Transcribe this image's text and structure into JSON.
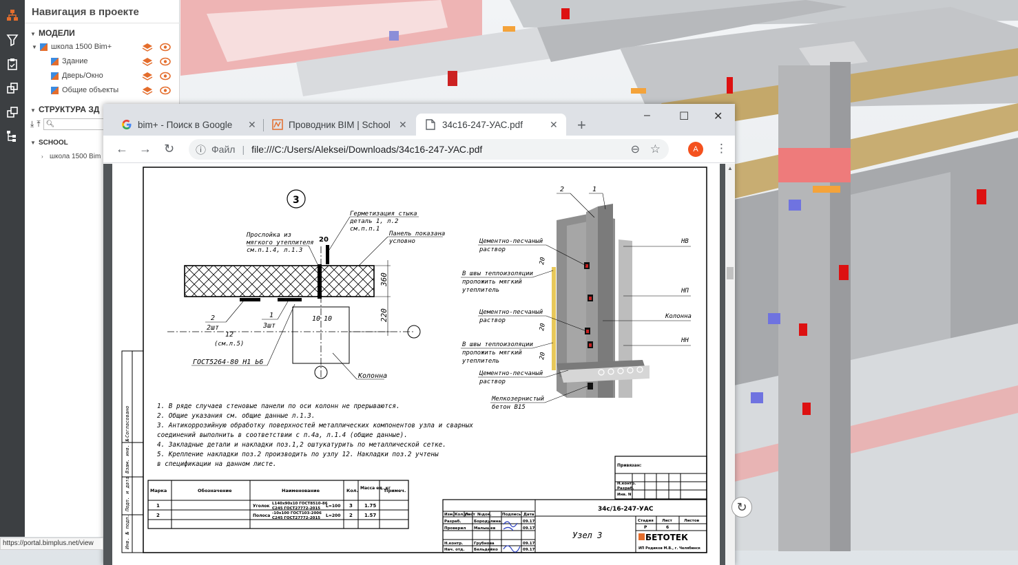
{
  "nav": {
    "title": "Навигация в проекте",
    "models_label": "МОДЕЛИ",
    "model_name": "школа 1500 Bim+",
    "sub_items": [
      "Здание",
      "Дверь/Окно",
      "Общие объекты"
    ],
    "structure_label": "СТРУКТУРА ЗД",
    "school_label": "SCHOOL",
    "school_item": "школа 1500 Bim"
  },
  "browser": {
    "tabs": [
      {
        "title": "bim+ - Поиск в Google",
        "icon": "google-icon"
      },
      {
        "title": "Проводник BIM | School",
        "icon": "bimplus-icon"
      },
      {
        "title": "34c16-247-УАС.pdf",
        "icon": "document-icon"
      }
    ],
    "new_tab": "+",
    "window_controls": {
      "minimize": "–",
      "maximize": "☐",
      "close": "✕"
    },
    "address_label": "Файл",
    "url": "file:///C:/Users/Aleksei/Downloads/34c16-247-УАС.pdf",
    "avatar_letter": "A"
  },
  "drawing": {
    "node_number": "3",
    "labels": {
      "seal": "Герметизация стыка",
      "seal2": "деталь 1, л.2",
      "seal3": "см.п.п.1",
      "panel": "Панель показана",
      "panel2": "условно",
      "gasket": "Прослойка из",
      "gasket2": "мягкого утеплителя",
      "gasket3": "см.п.1.4, л.1.3",
      "d20": "20",
      "d360": "360",
      "d220": "220",
      "d10a": "10",
      "d10b": "10",
      "p2": "2",
      "p2qty": "2шт",
      "p1": "1",
      "p1qty": "3шт",
      "p12": "12",
      "p12ref": "(см.л.5)",
      "gost": "ГОСТ5264-80 Н1 Ь6",
      "column": "Колонна"
    },
    "iso_labels": {
      "n2": "2",
      "n1": "1",
      "mortar1": "Цементно-песчаный",
      "mortar1b": "раствор",
      "joints1": "В швы теплоизоляции",
      "joints1b": "проложить мягкий",
      "joints1c": "утеплитель",
      "mortar2": "Цементно-песчаный",
      "mortar2b": "раствор",
      "joints2": "В швы теплоизоляции",
      "joints2b": "проложить мягкий",
      "joints2c": "утеплитель",
      "mortar3": "Цементно-песчаный",
      "mortar3b": "раствор",
      "concrete": "Мелкозернистый",
      "concrete2": "бетон В15",
      "hv": "НВ",
      "np": "НП",
      "column": "Колонна",
      "nn": "НН",
      "d20a": "20",
      "d20b": "20",
      "d20c": "20"
    },
    "notes": [
      "1. В ряде случаев стеновые панели по оси колонн не прерываются.",
      "2. Общие указания см. общие данные л.1.3.",
      "3. Антикоррозийную обработку поверхностей металлических компонентов узла и сварных",
      "соединений выполнить в соответствии с п.4а, л.1.4 (общие данные).",
      "4. Закладные детали и накладки поз.1,2 оштукатурить по металлической сетке.",
      "5. Крепление накладки поз.2 производить по узлу 12. Накладки поз.2 учтены",
      "в спецификации на данном листе."
    ],
    "spec_headers": [
      "Марка",
      "Обозначение",
      "Наименование",
      "Кол.",
      "Масса ед.,кг",
      "Примеч."
    ],
    "spec_rows": [
      {
        "mark": "1",
        "name_a": "Уголок",
        "name_b": "L140x90x10 ГОСТ8510-86",
        "name_c": "С245 ГОСТ27772-2015",
        "len": "L=100",
        "qty": "3",
        "mass": "1.75"
      },
      {
        "mark": "2",
        "name_a": "Полоса",
        "name_b": "-10x100 ГОСТ103-2006",
        "name_c": "С245 ГОСТ27772-2015",
        "len": "L=200",
        "qty": "2",
        "mass": "1.57"
      }
    ],
    "side_stamp": [
      "Согласовано",
      "Взам. инв. №",
      "Подп. и дата",
      "Инв. № подл."
    ],
    "approval": {
      "title": "Привязан:",
      "rows": [
        "Н.контр.",
        "Разраб.",
        "Инв. N"
      ]
    },
    "title_block": {
      "code": "34с/16-247-УАС",
      "node": "Узел 3",
      "header_cells": [
        "Изм.",
        "Кол.уч",
        "Лист",
        "№док.",
        "Подпись",
        "Дата"
      ],
      "people": [
        {
          "role": "Разраб.",
          "name": "Бородулина",
          "date": "09.17"
        },
        {
          "role": "Проверил",
          "name": "Малышев",
          "date": "09.17"
        },
        {
          "role": "Н.контр.",
          "name": "Грубнова",
          "date": "09.17"
        },
        {
          "role": "Нач. отд.",
          "name": "Бельдейко",
          "date": "09.17"
        }
      ],
      "stage_label": "Стадия",
      "sheet_label": "Лист",
      "sheets_label": "Листов",
      "stage": "Р",
      "sheet": "6",
      "company": "БЕТОТЕК",
      "company_sub": "ИП Родиков М.В., г. Челябинск"
    }
  },
  "status_url": "https://portal.bimplus.net/view",
  "colors": {
    "accent": "#e46d2c",
    "toolbar": "#3c3f42"
  }
}
